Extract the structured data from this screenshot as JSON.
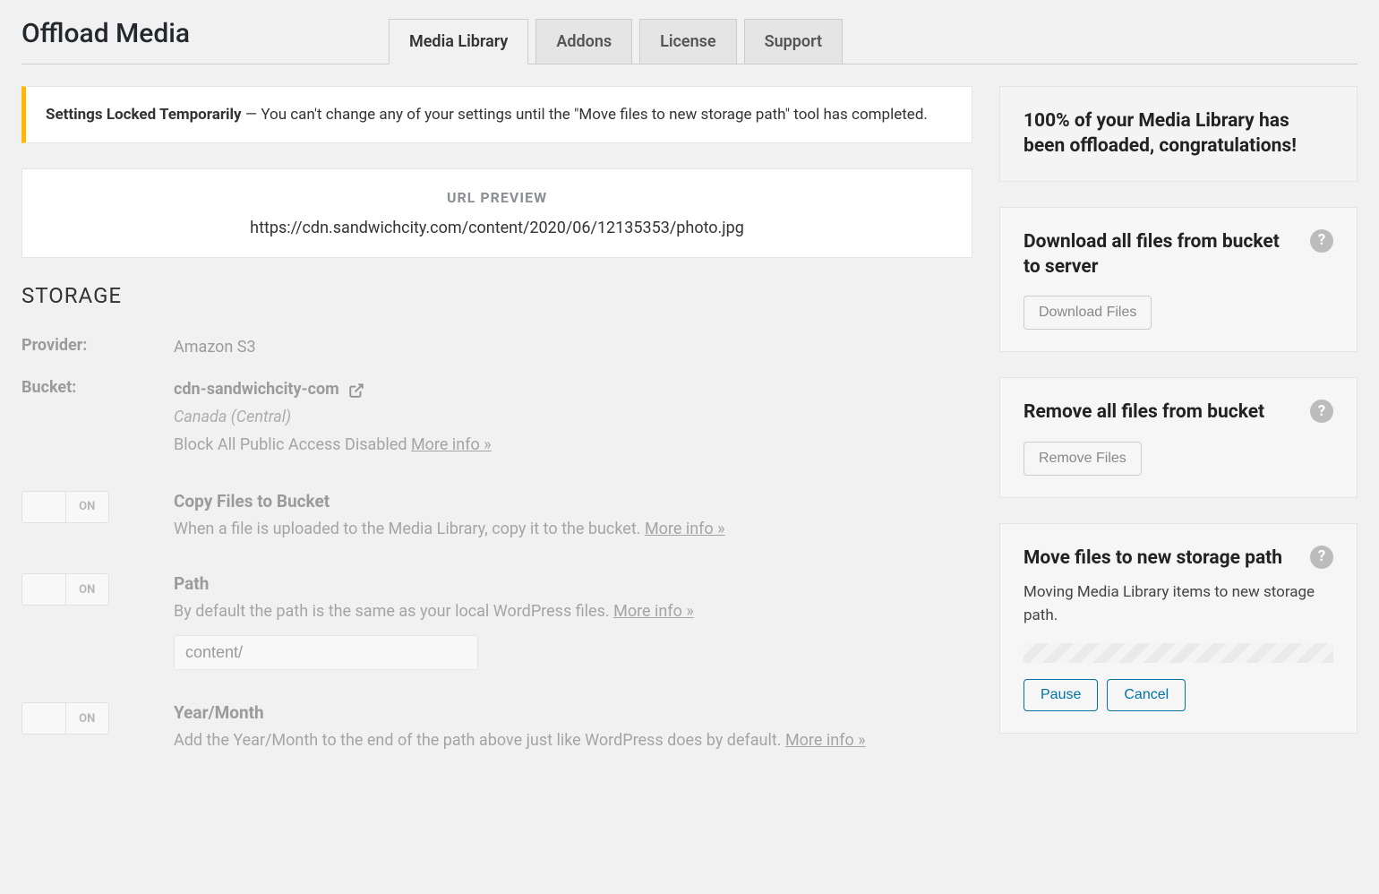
{
  "header": {
    "title": "Offload Media",
    "tabs": [
      {
        "label": "Media Library",
        "active": true
      },
      {
        "label": "Addons",
        "active": false
      },
      {
        "label": "License",
        "active": false
      },
      {
        "label": "Support",
        "active": false
      }
    ]
  },
  "notice": {
    "strong": "Settings Locked Temporarily",
    "sep": " — ",
    "text": "You can't change any of your settings until the \"Move files to new storage path\" tool has completed."
  },
  "url_preview": {
    "label": "URL PREVIEW",
    "value": "https://cdn.sandwichcity.com/content/2020/06/12135353/photo.jpg"
  },
  "storage": {
    "heading": "STORAGE",
    "provider_label": "Provider:",
    "provider_value": "Amazon S3",
    "bucket_label": "Bucket:",
    "bucket_value": "cdn-sandwichcity-com",
    "region": "Canada (Central)",
    "bpa_text": "Block All Public Access Disabled ",
    "bpa_more": "More info »",
    "toggles": [
      {
        "on_label": "ON",
        "title": "Copy Files to Bucket",
        "desc": "When a file is uploaded to the Media Library, copy it to the bucket. ",
        "more": "More info »"
      },
      {
        "on_label": "ON",
        "title": "Path",
        "desc": "By default the path is the same as your local WordPress files. ",
        "more": "More info »",
        "input_value": "content/"
      },
      {
        "on_label": "ON",
        "title": "Year/Month",
        "desc": "Add the Year/Month to the end of the path above just like WordPress does by default. ",
        "more": "More info »"
      }
    ]
  },
  "sidebar": {
    "congrats": "100% of your Media Library has been offloaded, congratulations!",
    "download": {
      "title": "Download all files from bucket to server",
      "button": "Download Files"
    },
    "remove": {
      "title": "Remove all files from bucket",
      "button": "Remove Files"
    },
    "move": {
      "title": "Move files to new storage path",
      "desc": "Moving Media Library items to new storage path.",
      "pause": "Pause",
      "cancel": "Cancel"
    },
    "help_glyph": "?"
  }
}
